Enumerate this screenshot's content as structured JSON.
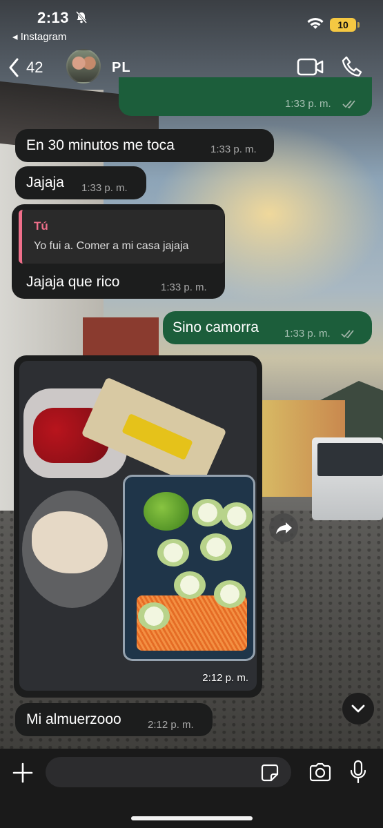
{
  "status_bar": {
    "time": "2:13",
    "back_app": "◂ Instagram",
    "battery": "10"
  },
  "header": {
    "back_count": "42",
    "contact_name": "PL"
  },
  "messages": [
    {
      "type": "out",
      "text": "",
      "time": "1:33 p. m."
    },
    {
      "type": "in",
      "text": "En 30 minutos me toca",
      "time": "1:33 p. m."
    },
    {
      "type": "in",
      "text": "Jajaja",
      "time": "1:33 p. m."
    },
    {
      "type": "in",
      "reply_author": "Tú",
      "reply_text": "Yo fui a. Comer a mi casa jajaja",
      "text": "Jajaja que rico",
      "time": "1:33 p. m."
    },
    {
      "type": "out",
      "text": "Sino camorra",
      "time": "1:33 p. m."
    },
    {
      "type": "in-photo",
      "time": "2:12 p. m."
    },
    {
      "type": "in",
      "text": "Mi almuerzooo",
      "time": "2:12 p. m."
    }
  ],
  "input": {
    "placeholder": ""
  },
  "colors": {
    "incoming": "#1c1d1d",
    "outgoing": "#1c5e3b",
    "quote_accent": "#ef6f8a",
    "battery": "#f5c842"
  },
  "icons": [
    "bell-off-icon",
    "wifi-icon",
    "chevron-left-icon",
    "video-icon",
    "phone-icon",
    "double-check-icon",
    "share-icon",
    "chevron-down-icon",
    "plus-icon",
    "sticker-icon",
    "camera-icon",
    "mic-icon"
  ]
}
